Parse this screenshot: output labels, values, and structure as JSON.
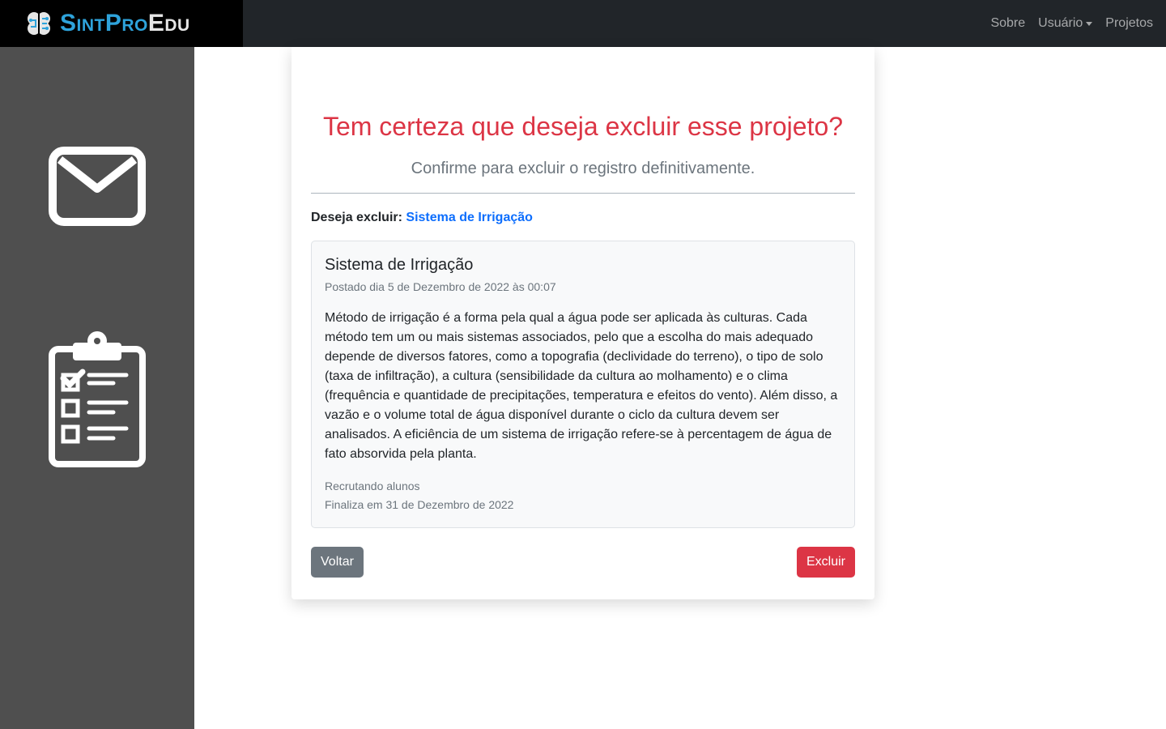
{
  "brand": {
    "part1": "Sint",
    "part2": "Pro",
    "part3": "Edu"
  },
  "nav": {
    "about": "Sobre",
    "user": "Usuário",
    "projects": "Projetos"
  },
  "sidebar": {
    "items": [
      {
        "icon": "envelope-icon"
      },
      {
        "icon": "clipboard-checklist-icon"
      }
    ]
  },
  "dialog": {
    "title": "Tem certeza que deseja excluir esse projeto?",
    "subtitle": "Confirme para excluir o registro definitivamente.",
    "delete_prompt": "Deseja excluir:",
    "delete_target": "Sistema de Irrigação"
  },
  "project": {
    "title": "Sistema de Irrigação",
    "posted": "Postado dia 5 de Dezembro de 2022 às 00:07",
    "description": "Método de irrigação é a forma pela qual a água pode ser aplicada às culturas. Cada método tem um ou mais sistemas associados, pelo que a escolha do mais adequado depende de diversos fatores, como a topografia (declividade do terreno), o tipo de solo (taxa de infiltração), a cultura (sensibilidade da cultura ao molhamento) e o clima (frequência e quantidade de precipitações, temperatura e efeitos do vento). Além disso, a vazão e o volume total de água disponível durante o ciclo da cultura devem ser analisados. A eficiência de um sistema de irrigação refere-se à percentagem de água de fato absorvida pela planta.",
    "status": "Recrutando alunos",
    "ends": "Finaliza em 31 de Dezembro de 2022"
  },
  "actions": {
    "back_label": "Voltar",
    "delete_label": "Excluir"
  },
  "colors": {
    "danger": "#dc3545",
    "primary": "#0d6efd",
    "secondary": "#6c757d",
    "navbar": "#212529",
    "sidebar": "#4f4f4f"
  }
}
